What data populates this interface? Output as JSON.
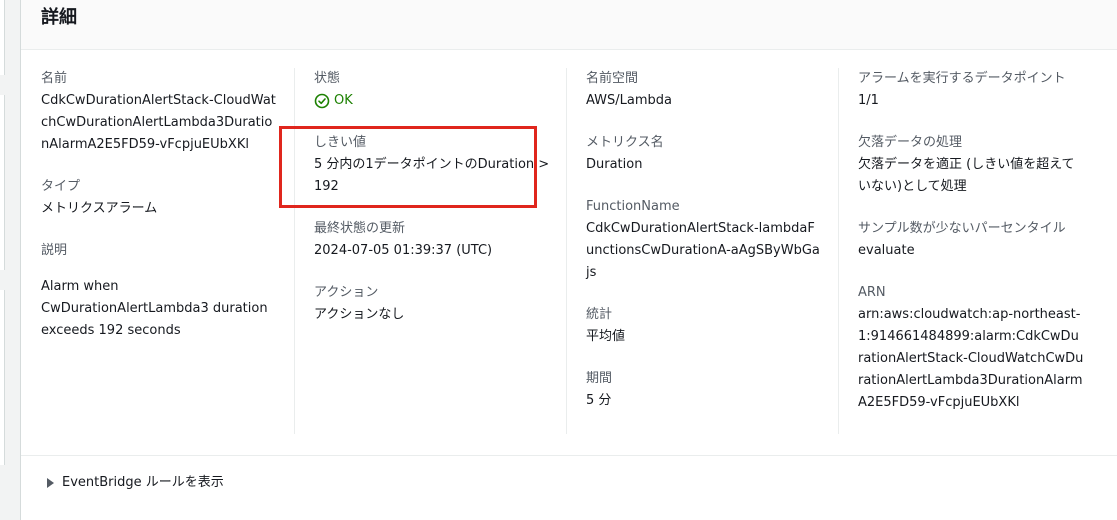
{
  "panel": {
    "title": "詳細"
  },
  "col1": {
    "name_label": "名前",
    "name_value": "CdkCwDurationAlertStack-CloudWatchCwDurationAlertLambda3DurationAlarmA2E5FD59-vFcpjuEUbXKl",
    "type_label": "タイプ",
    "type_value": "メトリクスアラーム",
    "desc_label": "説明",
    "desc_value": "Alarm when CwDurationAlertLambda3 duration exceeds 192 seconds"
  },
  "col2": {
    "state_label": "状態",
    "state_value": "OK",
    "threshold_label": "しきい値",
    "threshold_value": "5 分内の1データポイントのDuration > 192",
    "last_update_label": "最終状態の更新",
    "last_update_value": "2024-07-05 01:39:37 (UTC)",
    "action_label": "アクション",
    "action_value": "アクションなし"
  },
  "col3": {
    "namespace_label": "名前空間",
    "namespace_value": "AWS/Lambda",
    "metric_label": "メトリクス名",
    "metric_value": "Duration",
    "function_label": "FunctionName",
    "function_value": "CdkCwDurationAlertStack-lambdaFunctionsCwDurationA-aAgSByWbGajs",
    "stat_label": "統計",
    "stat_value": "平均値",
    "period_label": "期間",
    "period_value": "5 分"
  },
  "col4": {
    "datapoints_label": "アラームを実行するデータポイント",
    "datapoints_value": "1/1",
    "missing_label": "欠落データの処理",
    "missing_value": "欠落データを適正 (しきい値を超えていない)として処理",
    "sample_label": "サンプル数が少ないパーセンタイル",
    "sample_value": "evaluate",
    "arn_label": "ARN",
    "arn_value": "arn:aws:cloudwatch:ap-northeast-1:914661484899:alarm:CdkCwDurationAlertStack-CloudWatchCwDurationAlertLambda3DurationAlarmA2E5FD59-vFcpjuEUbXKl"
  },
  "footer": {
    "eventbridge_label": "EventBridge ルールを表示"
  },
  "colors": {
    "ok": "#1d8102",
    "highlight": "#e0261d",
    "label": "#545b64"
  },
  "icons": {
    "state": "check-circle-icon",
    "expand": "caret-right-icon"
  }
}
